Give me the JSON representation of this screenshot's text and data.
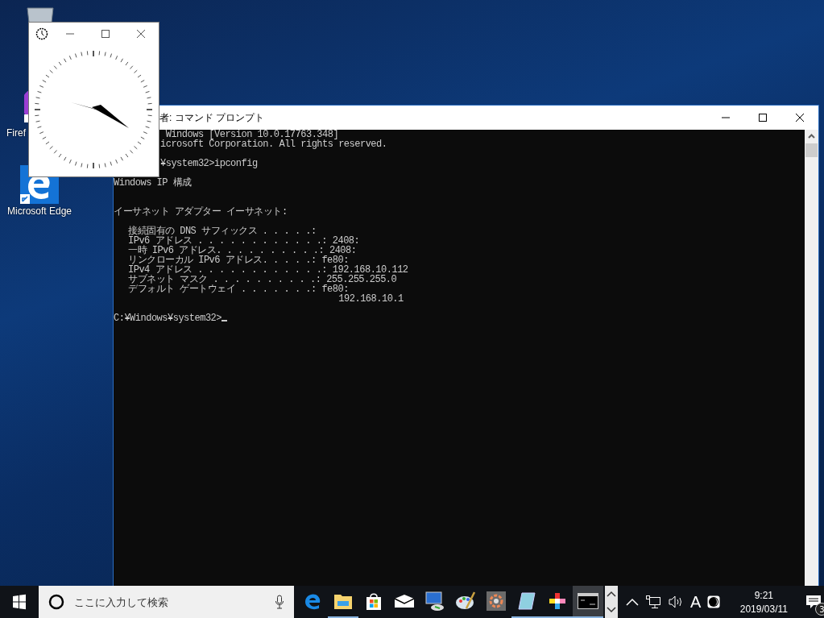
{
  "desktop_icons": [
    {
      "kind": "recycle"
    },
    {
      "kind": "firefox",
      "label": "Firef"
    },
    {
      "kind": "edge",
      "label": "Microsoft Edge"
    }
  ],
  "console_window": {
    "title": "者: コマンド プロンプト",
    "blocks": [
      {
        "kind": "partial",
        "lines": [
          " Windows [Version 10.0.17763.348]",
          "icrosoft Corporation. All rights reserved."
        ]
      },
      {
        "kind": "partial",
        "lines": [
          "¥system32>ipconfig"
        ]
      },
      {
        "kind": "plain",
        "lines": [
          "Windows IP 構成"
        ]
      },
      {
        "kind": "plain",
        "lines": [
          "イーサネット アダプター イーサネット:"
        ]
      },
      {
        "kind": "indented",
        "lines": [
          "接続固有の DNS サフィックス . . . . .:",
          "IPv6 アドレス . . . . . . . . . . . .: 2408:",
          "一時 IPv6 アドレス. . . . . . . . . .: 2408:",
          "リンクローカル IPv6 アドレス. . . . .: fe80:",
          "IPv4 アドレス . . . . . . . . . . . .: 192.168.10.112",
          "サブネット マスク . . . . . . . . . .: 255.255.255.0",
          "デフォルト ゲートウェイ . . . . . . .: fe80:",
          "                                       192.168.10.1"
        ]
      },
      {
        "kind": "prompt",
        "lines": [
          "C:¥Windows¥system32>"
        ]
      }
    ]
  },
  "taskbar": {
    "search": {
      "placeholder": "ここに入力して検索"
    },
    "apps": [
      {
        "kind": "edge",
        "running": false,
        "selected": false
      },
      {
        "kind": "explorer",
        "running": true,
        "selected": false
      },
      {
        "kind": "store",
        "running": false,
        "selected": false
      },
      {
        "kind": "mail",
        "running": false,
        "selected": false
      },
      {
        "kind": "remote",
        "running": false,
        "selected": false
      },
      {
        "kind": "paint",
        "running": false,
        "selected": false
      },
      {
        "kind": "tile",
        "running": false,
        "selected": false
      },
      {
        "kind": "notepad",
        "running": true,
        "selected": false
      },
      {
        "kind": "flower",
        "running": true,
        "selected": false
      },
      {
        "kind": "cmd",
        "running": true,
        "selected": true
      }
    ],
    "ime": "A",
    "time": "9:21",
    "date": "2019/03/11",
    "notifications": "3"
  }
}
